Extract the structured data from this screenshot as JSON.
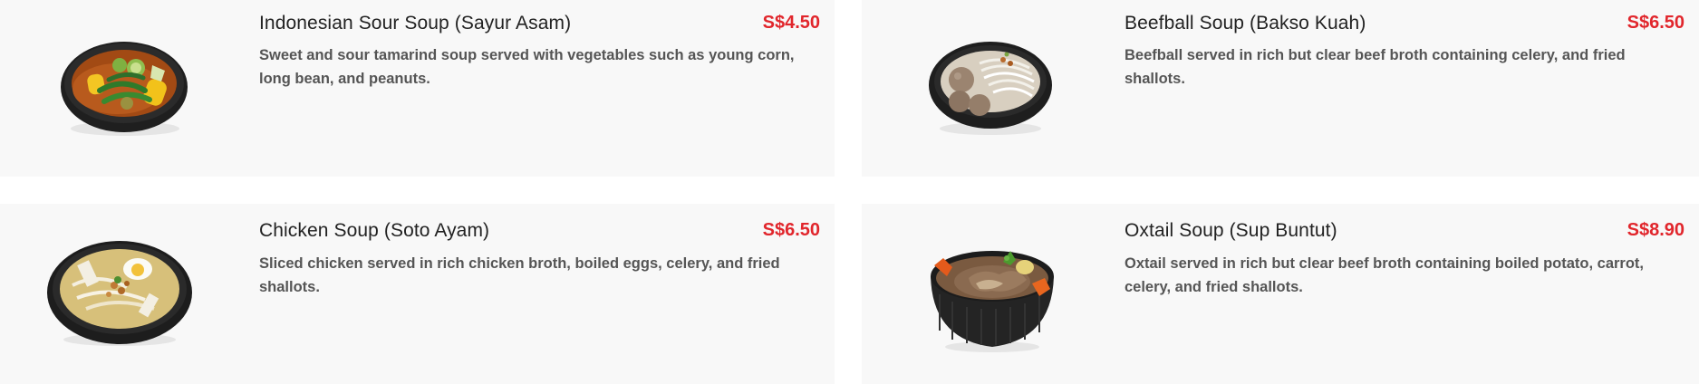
{
  "menu": {
    "items": [
      {
        "name": "Indonesian Sour Soup (Sayur Asam)",
        "price": "S$4.50",
        "description": "Sweet and sour tamarind soup served with vegetables such as young corn, long bean, and peanuts.",
        "image_icon": "sour-soup-bowl-icon"
      },
      {
        "name": "Beefball Soup (Bakso Kuah)",
        "price": "S$6.50",
        "description": "Beefball served in rich but clear beef broth containing celery, and fried shallots.",
        "image_icon": "beefball-soup-bowl-icon"
      },
      {
        "name": "Chicken Soup (Soto Ayam)",
        "price": "S$6.50",
        "description": "Sliced chicken served in rich chicken broth, boiled eggs, celery, and fried shallots.",
        "image_icon": "chicken-soup-bowl-icon"
      },
      {
        "name": "Oxtail Soup (Sup Buntut)",
        "price": "S$8.90",
        "description": "Oxtail served in rich but clear beef broth containing boiled potato, carrot, celery, and fried shallots.",
        "image_icon": "oxtail-soup-bowl-icon"
      }
    ]
  },
  "colors": {
    "price": "#e1262c",
    "card_background": "#f8f8f8",
    "title": "#222222",
    "description": "#555555"
  }
}
